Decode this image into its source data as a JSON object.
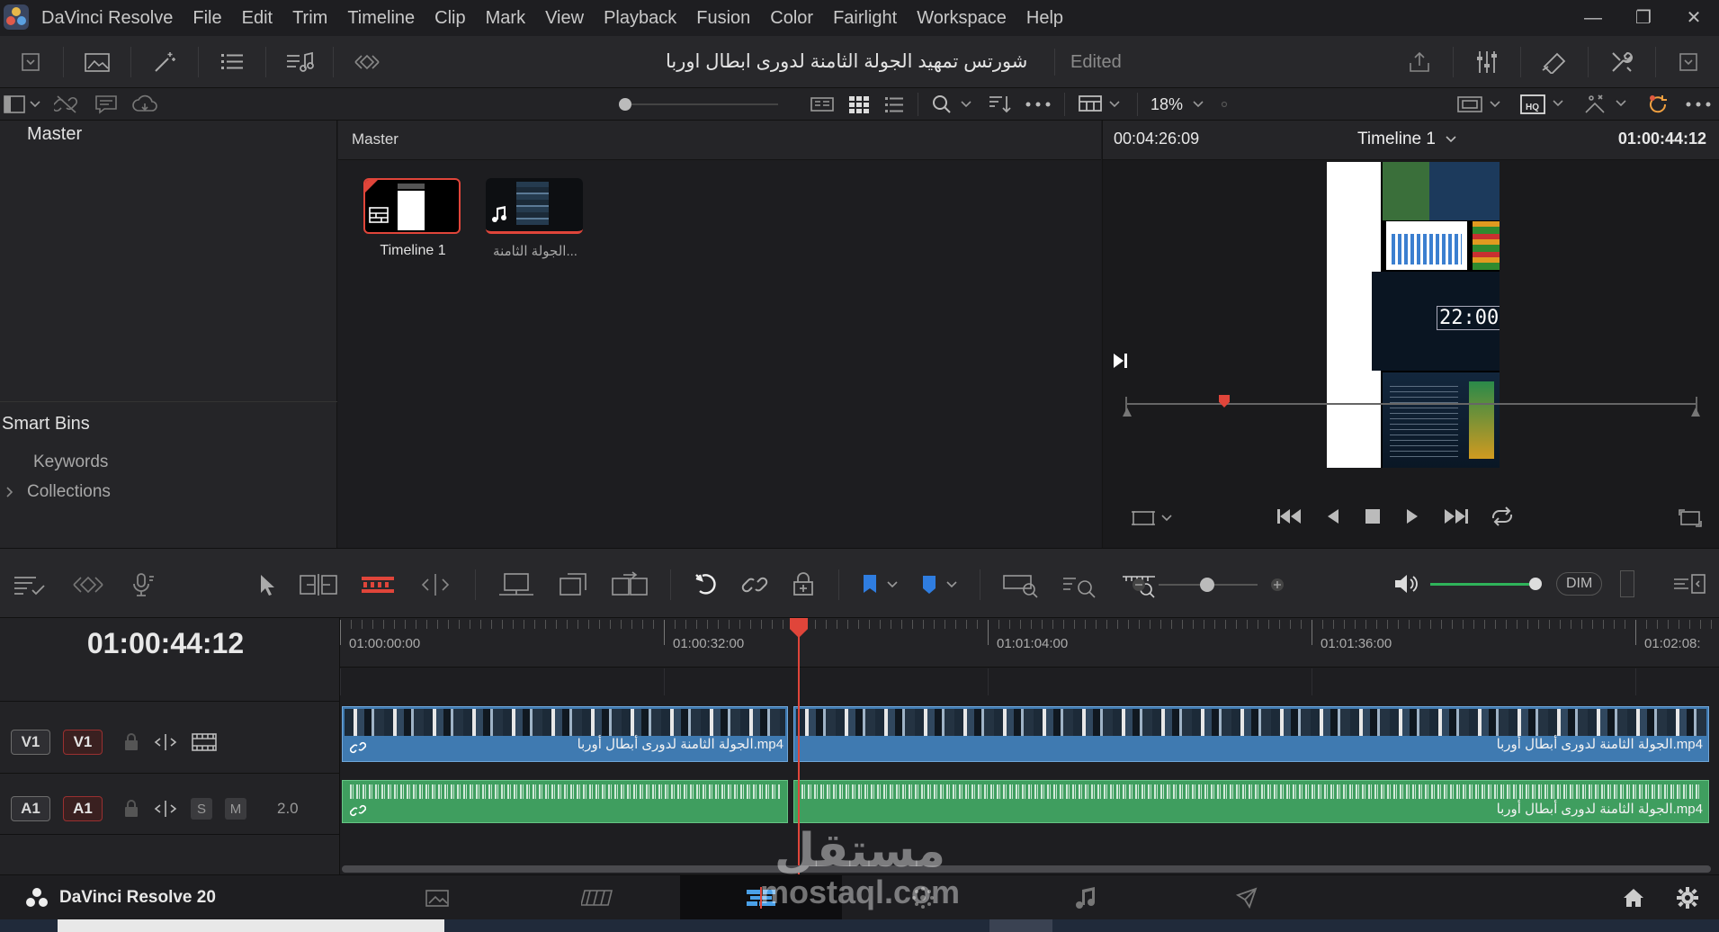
{
  "app": {
    "menu": [
      "DaVinci Resolve",
      "File",
      "Edit",
      "Trim",
      "Timeline",
      "Clip",
      "Mark",
      "View",
      "Playback",
      "Fusion",
      "Color",
      "Fairlight",
      "Workspace",
      "Help"
    ],
    "window_controls": [
      "—",
      "❐",
      "✕"
    ]
  },
  "project": {
    "title": "شورتس تمهيد الجولة الثامنة لدورى ابطال اوربا",
    "status": "Edited"
  },
  "toolbar2": {
    "zoom": "18%"
  },
  "bins": {
    "master": "Master",
    "smart_bins": "Smart Bins",
    "items": [
      "Keywords",
      "Collections"
    ]
  },
  "media_pool": {
    "breadcrumb": "Master",
    "clips": [
      {
        "name": "Timeline 1"
      },
      {
        "name": "الجولة الثامنة..."
      }
    ]
  },
  "viewer": {
    "source_tc": "00:04:26:09",
    "timeline_name": "Timeline 1",
    "record_tc": "01:00:44:12",
    "preview_clock": "22:00"
  },
  "timeline_toolbar": {
    "dim_label": "DIM"
  },
  "timeline": {
    "current_tc": "01:00:44:12",
    "ruler": [
      "01:00:00:00",
      "01:00:32:00",
      "01:01:04:00",
      "01:01:36:00",
      "01:02:08:"
    ],
    "video_track": {
      "dest": "V1",
      "src": "V1"
    },
    "audio_track": {
      "dest": "A1",
      "src": "A1",
      "solo": "S",
      "mute": "M",
      "channels": "2.0"
    },
    "clip_name": "الجولة الثامنة لدورى أبطال أوربا.mp4"
  },
  "pagebar": {
    "product": "DaVinci Resolve 20"
  },
  "watermark": {
    "text": "mostaql.com",
    "arabic": "مستقل"
  }
}
